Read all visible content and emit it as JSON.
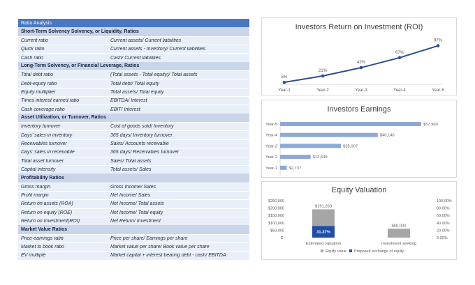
{
  "table": {
    "header": "Ratio Analysis",
    "sections": [
      {
        "title": "Short-Term Solvency Solvency, or Liquidity, Ratios",
        "rows": [
          [
            "Current ratio",
            "Current assets/ Current liabilities"
          ],
          [
            "Quick ratio",
            "Current assets - Inventory/ Current liabilities"
          ],
          [
            "Cash ratio",
            "Cash/ Current liabilities"
          ]
        ]
      },
      {
        "title": "Long-Term Solvency, or Financial Leverage, Ratios",
        "rows": [
          [
            "Total debt ratio",
            "(Total assets - Total equity)/ Total assets"
          ],
          [
            "Debt-equity ratio",
            "Total debt/ Total equity"
          ],
          [
            "Equity multiplier",
            "Total assets/ Total equity"
          ],
          [
            "Times interest earned ratio",
            "EBITDA/ Interest"
          ],
          [
            "Cash coverage ratio",
            "EBIT/ Interest"
          ]
        ]
      },
      {
        "title": "Asset Utilization, or Turnover, Ratios",
        "rows": [
          [
            "Inventory turnover",
            "Cost of goods sold/ Inventory"
          ],
          [
            "Days' sales in inventory",
            "365 days/ Inventory turnover"
          ],
          [
            "Receivables turnover",
            "Sales/ Accounts receivable"
          ],
          [
            "Days' sales in receivable",
            "365 days/ Receivables turnover"
          ],
          [
            "Total asset turnover",
            "Sales/ Total assets"
          ],
          [
            "Capital intensity",
            "Total assets/ Sales"
          ]
        ]
      },
      {
        "title": "Profitability Ratios",
        "rows": [
          [
            "Gross margin",
            "Gross Income/ Sales"
          ],
          [
            "Profit margin",
            "Net Income/ Sales"
          ],
          [
            "Return on assets (ROA)",
            "Net Income/ Total assets"
          ],
          [
            "Return on equity (ROE)",
            "Net Income/ Total equity"
          ],
          [
            "Return on Investment(ROI)",
            "Net Return/ Investment"
          ]
        ]
      },
      {
        "title": "Market Value Ratios",
        "rows": [
          [
            "Price-earnings ratio",
            "Price per share/ Earnings per share"
          ],
          [
            "Market to book ratio",
            "Market value per share/ Book value per share"
          ],
          [
            "EV multiple",
            "Market capital + interest bearing debt - cash/ EBITDA"
          ]
        ]
      }
    ]
  },
  "chart_data": [
    {
      "type": "line",
      "title": "Investors Return on Investment (ROI)",
      "categories": [
        "Year-1",
        "Year-2",
        "Year-3",
        "Year-4",
        "Year-5"
      ],
      "values": [
        5,
        21,
        42,
        67,
        97
      ],
      "labels": [
        "5%",
        "21%",
        "42%",
        "67%",
        "97%"
      ],
      "color": "#2e4f8f"
    },
    {
      "type": "bar",
      "orientation": "horizontal",
      "title": "Investors Earnings",
      "categories": [
        "Year-5",
        "Year-4",
        "Year-3",
        "Year-2",
        "Year-1"
      ],
      "values": [
        57960,
        40146,
        25007,
        12539,
        2737
      ],
      "labels": [
        "$57,960",
        "$40,146",
        "$25,007",
        "$12,539",
        "$2,737"
      ],
      "color": "#8ea9d8"
    },
    {
      "type": "bar",
      "title": "Equity Valuation",
      "categories": [
        "Estimated valuation",
        "Investment seeking"
      ],
      "series": [
        {
          "name": "Equity value",
          "values": [
            191263,
            60000
          ],
          "labels": [
            "$191,263",
            "$60,000"
          ],
          "color": "#a6a6a6"
        },
        {
          "name": "Proposed exchange of equity",
          "values": [
            31.37,
            null
          ],
          "labels": [
            "31.37%",
            ""
          ],
          "color": "#1f4ea8"
        }
      ],
      "y_ticks": [
        "$250,000",
        "$200,000",
        "$150,000",
        "$100,000",
        "$50,000",
        "$-"
      ],
      "y_ticks_right": [
        "100.00%",
        "80.00%",
        "60.00%",
        "40.00%",
        "20.00%",
        "0.00%"
      ],
      "ylim": [
        0,
        250000
      ],
      "ylim_right": [
        0,
        100
      ],
      "legend": "bottom"
    }
  ]
}
